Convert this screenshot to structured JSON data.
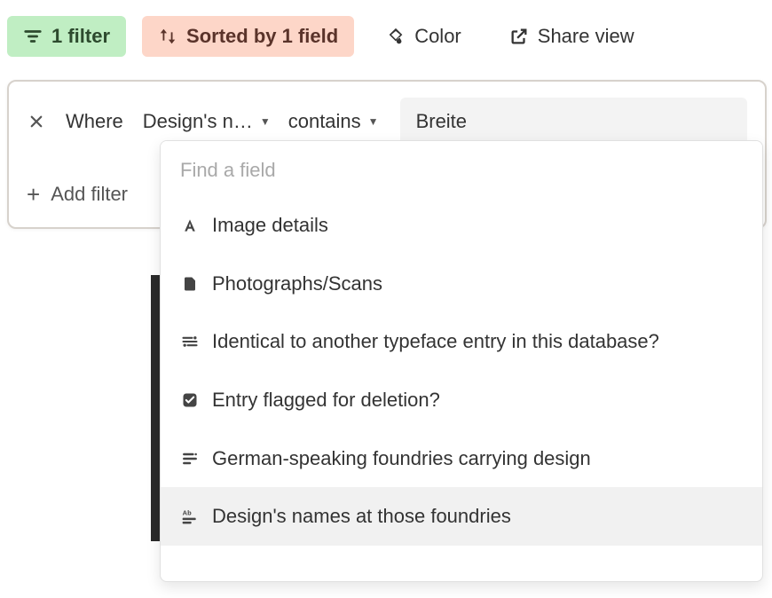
{
  "toolbar": {
    "filter_label": "1 filter",
    "sort_label": "Sorted by 1 field",
    "color_label": "Color",
    "share_label": "Share view"
  },
  "filter": {
    "where_label": "Where",
    "field_display": "Design's n…",
    "operator": "contains",
    "value": "Breite",
    "add_filter_label": "Add filter"
  },
  "field_picker": {
    "search_placeholder": "Find a field",
    "options": [
      {
        "icon": "text-icon",
        "label": "Image details"
      },
      {
        "icon": "attachment-icon",
        "label": "Photographs/Scans"
      },
      {
        "icon": "link-icon",
        "label": "Identical to another typeface entry in this database?"
      },
      {
        "icon": "checkbox-icon",
        "label": "Entry flagged for deletion?"
      },
      {
        "icon": "list-icon",
        "label": "German-speaking foundries carrying design"
      },
      {
        "icon": "lookup-icon",
        "label": "Design's names at those foundries"
      }
    ],
    "selected_index": 5
  }
}
